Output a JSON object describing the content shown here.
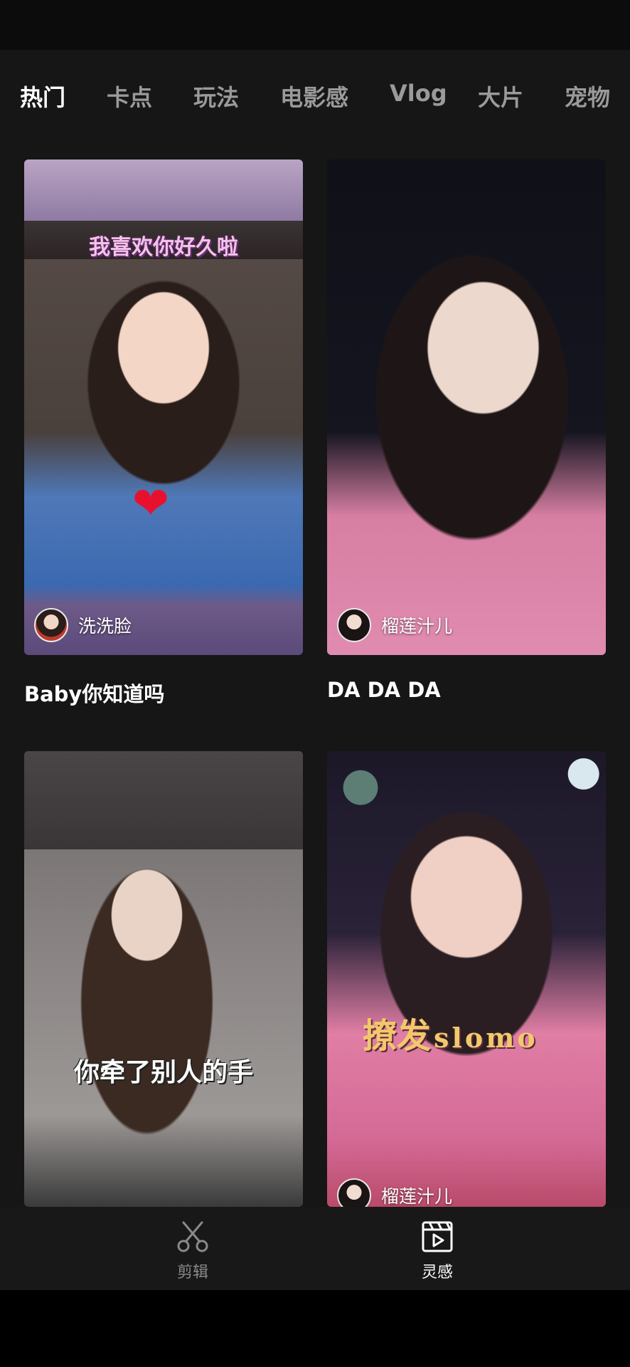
{
  "tabs": [
    {
      "label": "热门",
      "active": true
    },
    {
      "label": "卡点",
      "active": false
    },
    {
      "label": "玩法",
      "active": false
    },
    {
      "label": "电影感",
      "active": false
    },
    {
      "label": "Vlog",
      "active": false
    },
    {
      "label": "大片",
      "active": false
    },
    {
      "label": "宠物",
      "active": false
    }
  ],
  "cards": [
    {
      "title": "Baby你知道吗",
      "overlay_text": "我喜欢你好久啦",
      "author": "洗洗脸"
    },
    {
      "title": "DA DA DA",
      "author": "榴莲汁儿"
    },
    {
      "overlay_text": "你牵了别人的手"
    },
    {
      "overlay_text_main": "撩发",
      "overlay_text_sub": "slomo",
      "author": "榴莲汁儿"
    }
  ],
  "bottom_nav": [
    {
      "label": "剪辑",
      "icon": "scissors-icon",
      "active": false
    },
    {
      "label": "灵感",
      "icon": "clapperboard-icon",
      "active": true
    }
  ],
  "colors": {
    "background": "#161616",
    "tab_active": "#ffffff",
    "tab_inactive": "#9a9a9a",
    "nav_inactive": "#8a8a8a",
    "nav_active": "#ffffff"
  }
}
